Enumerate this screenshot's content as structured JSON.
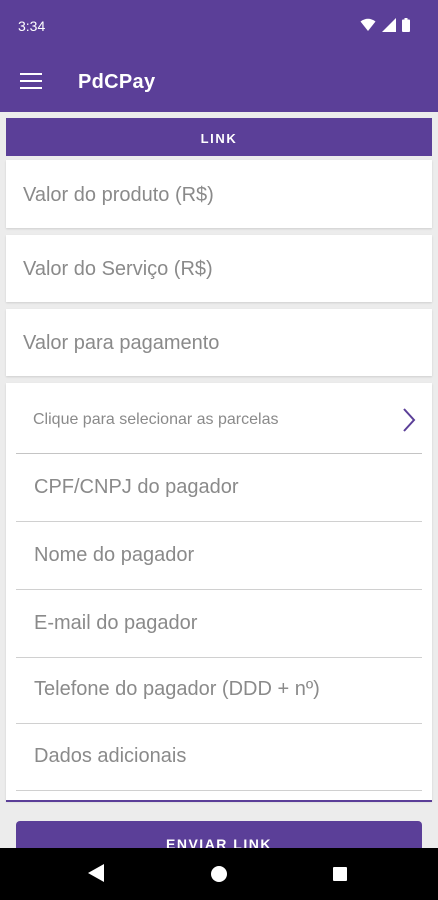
{
  "status_bar": {
    "time": "3:34"
  },
  "app_bar": {
    "title": "PdCPay"
  },
  "tab": {
    "label": "LINK"
  },
  "fields": {
    "produto": "Valor do produto (R$)",
    "servico": "Valor do Serviço (R$)",
    "pagamento": "Valor para pagamento"
  },
  "form": {
    "installments": "Clique para selecionar as parcelas",
    "cpf": "CPF/CNPJ do pagador",
    "nome": "Nome do pagador",
    "email": "E-mail do pagador",
    "telefone": "Telefone do pagador (DDD + nº)",
    "dados": "Dados adicionais"
  },
  "send_button": {
    "label": "ENVIAR LINK"
  },
  "colors": {
    "primary": "#5b3f98",
    "background": "#ececec",
    "hint": "#8a8a8a"
  }
}
